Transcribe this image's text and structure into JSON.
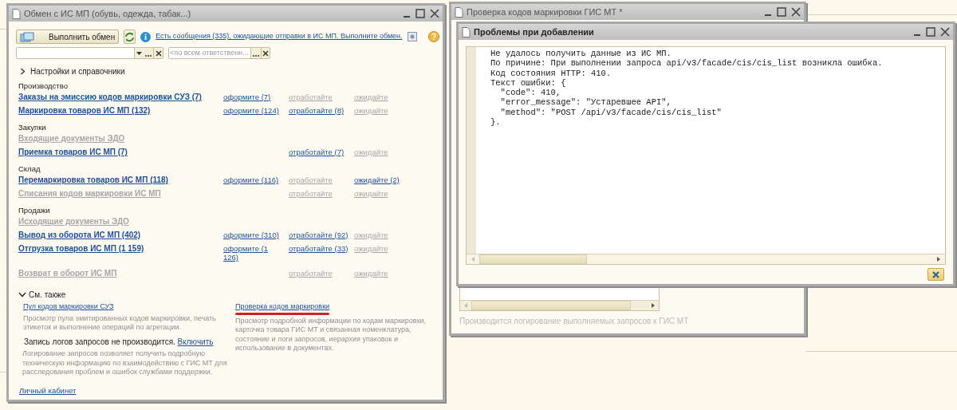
{
  "exchange_window": {
    "title": "Обмен с ИС МП (обувь, одежда, табак...)",
    "exchange_button": "Выполнить обмен",
    "messages_link": "Есть сообщения (335), ожидающие отправки в ИС МП. Выполните обмен.",
    "filter_2": {
      "placeholder": "<по всем ответственн..."
    },
    "settings_section": {
      "label": "Настройки и справочники",
      "expanded": false
    },
    "sections": [
      {
        "title": "Производство",
        "rows": [
          {
            "label": "Заказы на эмиссию кодов маркировки СУЗ (7)",
            "enabled": true,
            "to_issue": {
              "text": "оформите (7)",
              "enabled": true
            },
            "to_process": {
              "text": "отработайте",
              "enabled": false
            },
            "waiting": {
              "text": "ожидайте",
              "enabled": false
            }
          },
          {
            "label": "Маркировка товаров ИС МП (132)",
            "enabled": true,
            "to_issue": {
              "text": "оформите (124)",
              "enabled": true
            },
            "to_process": {
              "text": "отработайте (8)",
              "enabled": true
            },
            "waiting": {
              "text": "ожидайте",
              "enabled": false
            }
          }
        ]
      },
      {
        "title": "Закупки",
        "rows": [
          {
            "label": "Входящие документы ЭДО",
            "enabled": false
          },
          {
            "label": "Приемка товаров ИС МП (7)",
            "enabled": true,
            "to_process": {
              "text": "отработайте (7)",
              "enabled": true
            },
            "waiting": {
              "text": "ожидайте",
              "enabled": false
            }
          }
        ]
      },
      {
        "title": "Склад",
        "rows": [
          {
            "label": "Перемаркировка товаров ИС МП (118)",
            "enabled": true,
            "to_issue": {
              "text": "оформите (116)",
              "enabled": true
            },
            "to_process": {
              "text": "отработайте",
              "enabled": false
            },
            "waiting": {
              "text": "ожидайте (2)",
              "enabled": true
            }
          },
          {
            "label": "Списания кодов маркировки ИС МП",
            "enabled": false,
            "to_process": {
              "text": "отработайте",
              "enabled": false
            },
            "waiting": {
              "text": "ожидайте",
              "enabled": false
            }
          }
        ]
      },
      {
        "title": "Продажи",
        "rows": [
          {
            "label": "Исходящие документы ЭДО",
            "enabled": false
          },
          {
            "label": "Вывод из оборота ИС МП (402)",
            "enabled": true,
            "to_issue": {
              "text": "оформите (310)",
              "enabled": true
            },
            "to_process": {
              "text": "отработайте (92)",
              "enabled": true
            },
            "waiting": {
              "text": "ожидайте",
              "enabled": false
            }
          },
          {
            "label": "Отгрузка товаров ИС МП (1 159)",
            "enabled": true,
            "to_issue": {
              "text": "оформите (1 126)",
              "enabled": true
            },
            "to_process": {
              "text": "отработайте (33)",
              "enabled": true
            },
            "waiting": {
              "text": "ожидайте",
              "enabled": false
            }
          },
          {
            "label": "Возврат в оборот ИС МП",
            "enabled": false,
            "to_process": {
              "text": "отработайте",
              "enabled": false
            },
            "waiting": {
              "text": "ожидайте",
              "enabled": false
            }
          }
        ]
      }
    ],
    "see_also": {
      "label": "См. также",
      "expanded": true,
      "left": {
        "link": "Пул кодов маркировки СУЗ",
        "description": "Просмотр пула эмитированных кодов маркировки, печать этикеток и выполнение операций по агрегации.",
        "log_status": "Запись логов запросов не производится.",
        "log_link": "Включить",
        "log_description": "Логирование запросов позволяет получить подробную техническую информацию по взаимодействию с ГИС МТ для расследования проблем и ошибок службами поддержки."
      },
      "right": {
        "link": "Проверка кодов маркировки",
        "description": "Просмотр подробной информации по кодам маркировки, карточка товара ГИС МТ и связанная номенклатура, состояние и логи запросов, иерархия упаковок и использование в документах."
      }
    },
    "cabinet_link": "Личный кабинет"
  },
  "check_window": {
    "title": "Проверка кодов маркировки ГИС МТ *",
    "log_note": "Производится логирование выполняемых запросов к ГИС МТ"
  },
  "problems_dialog": {
    "title": "Проблемы при добавлении",
    "lines": [
      "Не удалось получить данные из ИС МП.",
      "По причине: При выполнении запроса api/v3/facade/cis/cis_list возникла ошибка.",
      "Код состояния HTTP: 410.",
      "Текст ошибки: {",
      "  \"code\": 410,",
      "  \"error_message\": \"Устаревшее API\",",
      "  \"method\": \"POST /api/v3/facade/cis/cis_list\"",
      "}."
    ]
  }
}
